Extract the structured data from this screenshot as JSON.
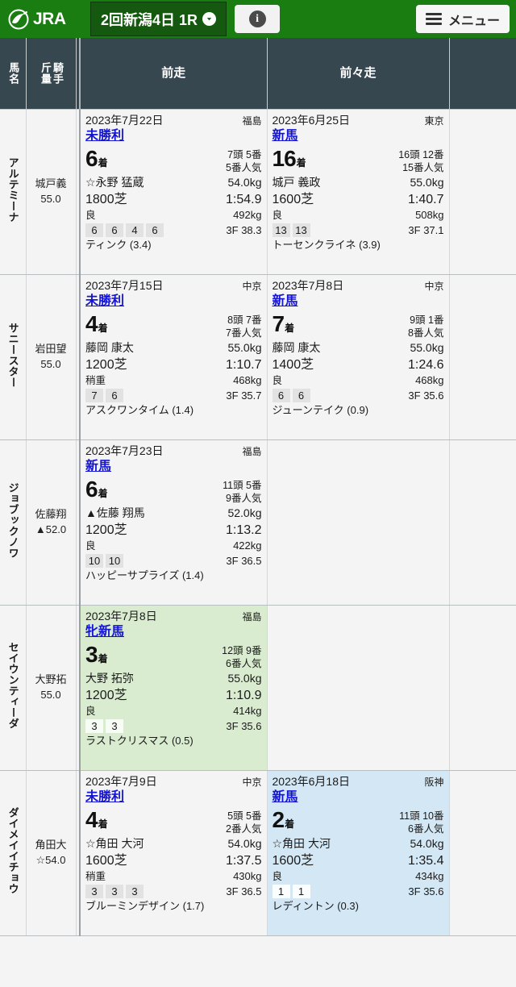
{
  "header": {
    "logo_text": "JRA",
    "logo_icon": "jra-horse-emblem-icon",
    "race_selector": "2回新潟4日 1R",
    "race_selector_caret": "❯",
    "info_glyph": "i",
    "menu_label": "メニュー",
    "bg_color": "#1a7d11",
    "selector_bg_color": "#14590f"
  },
  "table": {
    "headers": {
      "horse_name": "馬名",
      "jockey_weight": "騎手\n斤量",
      "jockey_weight_line1": "騎手",
      "jockey_weight_line2": "斤量",
      "prev_race": "前走",
      "prev2_race": "前々走",
      "extra": ""
    },
    "header_bg": "#36474f",
    "rows": [
      {
        "horse": "アルテミーナ",
        "jockey_short": "城戸義",
        "jockey_weight": "55.0",
        "races": [
          {
            "date": "2023年7月22日",
            "course": "福島",
            "race_class": "未勝利",
            "finish": "6",
            "finish_suffix": "着",
            "field": "7頭 5番",
            "popularity": "5番人気",
            "jockey": "☆永野 猛蔵",
            "weight": "54.0kg",
            "distance": "1800芝",
            "time": "1:54.9",
            "condition": "良",
            "body_weight": "492kg",
            "corners": [
              "6",
              "6",
              "4",
              "6"
            ],
            "last3f": "3F 38.3",
            "rival": "ティンク (3.4)",
            "highlight": "none"
          },
          {
            "date": "2023年6月25日",
            "course": "東京",
            "race_class": "新馬",
            "finish": "16",
            "finish_suffix": "着",
            "field": "16頭 12番",
            "popularity": "15番人気",
            "jockey": "城戸 義政",
            "weight": "55.0kg",
            "distance": "1600芝",
            "time": "1:40.7",
            "condition": "良",
            "body_weight": "508kg",
            "corners": [
              "13",
              "13"
            ],
            "last3f": "3F 37.1",
            "rival": "トーセンクライネ (3.9)",
            "highlight": "none"
          }
        ]
      },
      {
        "horse": "サニースター",
        "jockey_short": "岩田望",
        "jockey_weight": "55.0",
        "races": [
          {
            "date": "2023年7月15日",
            "course": "中京",
            "race_class": "未勝利",
            "finish": "4",
            "finish_suffix": "着",
            "field": "8頭 7番",
            "popularity": "7番人気",
            "jockey": "藤岡 康太",
            "weight": "55.0kg",
            "distance": "1200芝",
            "time": "1:10.7",
            "condition": "稍重",
            "body_weight": "468kg",
            "corners": [
              "7",
              "6"
            ],
            "last3f": "3F 35.7",
            "rival": "アスクワンタイム (1.4)",
            "highlight": "none"
          },
          {
            "date": "2023年7月8日",
            "course": "中京",
            "race_class": "新馬",
            "finish": "7",
            "finish_suffix": "着",
            "field": "9頭 1番",
            "popularity": "8番人気",
            "jockey": "藤岡 康太",
            "weight": "55.0kg",
            "distance": "1400芝",
            "time": "1:24.6",
            "condition": "良",
            "body_weight": "468kg",
            "corners": [
              "6",
              "6"
            ],
            "last3f": "3F 35.6",
            "rival": "ジューンテイク (0.9)",
            "highlight": "none"
          }
        ]
      },
      {
        "horse": "ジョブックノワ",
        "jockey_short": "佐藤翔",
        "jockey_weight": "▲52.0",
        "races": [
          {
            "date": "2023年7月23日",
            "course": "福島",
            "race_class": "新馬",
            "finish": "6",
            "finish_suffix": "着",
            "field": "11頭 5番",
            "popularity": "9番人気",
            "jockey": "▲佐藤 翔馬",
            "weight": "52.0kg",
            "distance": "1200芝",
            "time": "1:13.2",
            "condition": "良",
            "body_weight": "422kg",
            "corners": [
              "10",
              "10"
            ],
            "last3f": "3F 36.5",
            "rival": "ハッピーサプライズ (1.4)",
            "highlight": "none"
          },
          null
        ]
      },
      {
        "horse": "セイウンティーダ",
        "jockey_short": "大野拓",
        "jockey_weight": "55.0",
        "races": [
          {
            "date": "2023年7月8日",
            "course": "福島",
            "race_class": "牝新馬",
            "finish": "3",
            "finish_suffix": "着",
            "field": "12頭 9番",
            "popularity": "6番人気",
            "jockey": "大野 拓弥",
            "weight": "55.0kg",
            "distance": "1200芝",
            "time": "1:10.9",
            "condition": "良",
            "body_weight": "414kg",
            "corners": [
              "3",
              "3"
            ],
            "last3f": "3F 35.6",
            "rival": "ラストクリスマス (0.5)",
            "highlight": "green"
          },
          null
        ]
      },
      {
        "horse": "ダイメイイチョウ",
        "jockey_short": "角田大",
        "jockey_weight": "☆54.0",
        "races": [
          {
            "date": "2023年7月9日",
            "course": "中京",
            "race_class": "未勝利",
            "finish": "4",
            "finish_suffix": "着",
            "field": "5頭 5番",
            "popularity": "2番人気",
            "jockey": "☆角田 大河",
            "weight": "54.0kg",
            "distance": "1600芝",
            "time": "1:37.5",
            "condition": "稍重",
            "body_weight": "430kg",
            "corners": [
              "3",
              "3",
              "3"
            ],
            "last3f": "3F 36.5",
            "rival": "ブルーミンデザイン (1.7)",
            "highlight": "none"
          },
          {
            "date": "2023年6月18日",
            "course": "阪神",
            "race_class": "新馬",
            "finish": "2",
            "finish_suffix": "着",
            "field": "11頭 10番",
            "popularity": "6番人気",
            "jockey": "☆角田 大河",
            "weight": "54.0kg",
            "distance": "1600芝",
            "time": "1:35.4",
            "condition": "良",
            "body_weight": "434kg",
            "corners": [
              "1",
              "1"
            ],
            "last3f": "3F 35.6",
            "rival": "レディントン (0.3)",
            "highlight": "blue"
          }
        ]
      }
    ]
  },
  "colors": {
    "link": "#1414d6",
    "highlight_green": "#d9ecd0",
    "highlight_blue": "#d3e7f4",
    "header_dark": "#36474f",
    "brand_green": "#1a7d11"
  }
}
